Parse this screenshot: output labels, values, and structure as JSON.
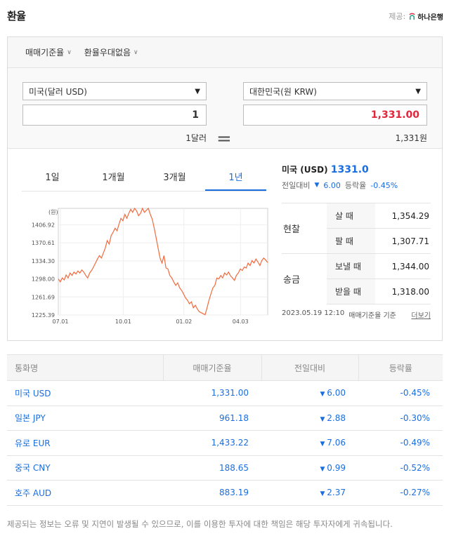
{
  "header": {
    "title": "환율",
    "provider_label": "제공:",
    "provider_name": "하나은행"
  },
  "filters": [
    {
      "label": "매매기준율"
    },
    {
      "label": "환율우대없음"
    }
  ],
  "converter": {
    "from_currency": "미국(달러 USD)",
    "from_amount": "1",
    "from_unit_text": "1달러",
    "to_currency": "대한민국(원 KRW)",
    "to_amount": "1,331.00",
    "to_unit_text": "1,331원",
    "to_amount_color": "#e0273c"
  },
  "tabs": [
    {
      "label": "1일"
    },
    {
      "label": "1개월"
    },
    {
      "label": "3개월"
    },
    {
      "label": "1년",
      "active": true
    }
  ],
  "summary": {
    "currency_label": "미국 (USD)",
    "rate": "1331.0",
    "change_label": "전일대비",
    "change_value": "6.00",
    "pct_label": "등락율",
    "pct_value": "-0.45%"
  },
  "price_table": {
    "cash_label": "현찰",
    "remit_label": "송금",
    "rows": [
      {
        "kind": "살 때",
        "value": "1,354.29"
      },
      {
        "kind": "팔 때",
        "value": "1,307.71"
      },
      {
        "kind": "보낼 때",
        "value": "1,344.00"
      },
      {
        "kind": "받을 때",
        "value": "1,318.00"
      }
    ]
  },
  "footer": {
    "timestamp": "2023.05.19 12:10",
    "basis": "매매기준율 기준",
    "more": "더보기"
  },
  "chart_data": {
    "type": "line",
    "unit_label": "(원)",
    "x_ticks": [
      "07.01",
      "10.01",
      "01.02",
      "04.03"
    ],
    "y_ticks": [
      1406.92,
      1370.61,
      1334.3,
      1298.0,
      1261.69,
      1225.39
    ],
    "ylim": [
      1225.39,
      1440
    ],
    "series": [
      {
        "color": "#f26a3d",
        "values": [
          1298,
          1292,
          1300,
          1296,
          1306,
          1300,
          1310,
          1305,
          1312,
          1308,
          1314,
          1310,
          1316,
          1312,
          1305,
          1300,
          1310,
          1315,
          1322,
          1330,
          1338,
          1345,
          1340,
          1350,
          1360,
          1375,
          1368,
          1385,
          1392,
          1400,
          1395,
          1408,
          1420,
          1415,
          1428,
          1420,
          1430,
          1438,
          1432,
          1440,
          1435,
          1425,
          1430,
          1440,
          1432,
          1436,
          1440,
          1428,
          1418,
          1400,
          1380,
          1360,
          1340,
          1330,
          1345,
          1320,
          1318,
          1305,
          1300,
          1292,
          1285,
          1290,
          1280,
          1275,
          1268,
          1260,
          1255,
          1248,
          1252,
          1240,
          1245,
          1238,
          1232,
          1230,
          1228,
          1226,
          1240,
          1255,
          1268,
          1280,
          1285,
          1300,
          1298,
          1305,
          1300,
          1310,
          1306,
          1312,
          1304,
          1300,
          1295,
          1305,
          1310,
          1318,
          1315,
          1322,
          1320,
          1330,
          1325,
          1335,
          1330,
          1338,
          1332,
          1325,
          1335,
          1340,
          1336,
          1331
        ]
      }
    ]
  },
  "list": {
    "headers": [
      "통화명",
      "매매기준율",
      "전일대비",
      "등락률"
    ],
    "rows": [
      {
        "name": "미국 USD",
        "rate": "1,331.00",
        "change": "6.00",
        "pct": "-0.45%"
      },
      {
        "name": "일본 JPY",
        "rate": "961.18",
        "change": "2.88",
        "pct": "-0.30%"
      },
      {
        "name": "유로 EUR",
        "rate": "1,433.22",
        "change": "7.06",
        "pct": "-0.49%"
      },
      {
        "name": "중국 CNY",
        "rate": "188.65",
        "change": "0.99",
        "pct": "-0.52%"
      },
      {
        "name": "호주 AUD",
        "rate": "883.19",
        "change": "2.37",
        "pct": "-0.27%"
      }
    ]
  },
  "disclaimer": "제공되는 정보는 오류 및 지연이 발생될 수 있으므로, 이를 이용한 투자에 대한 책임은 해당 투자자에게 귀속됩니다."
}
